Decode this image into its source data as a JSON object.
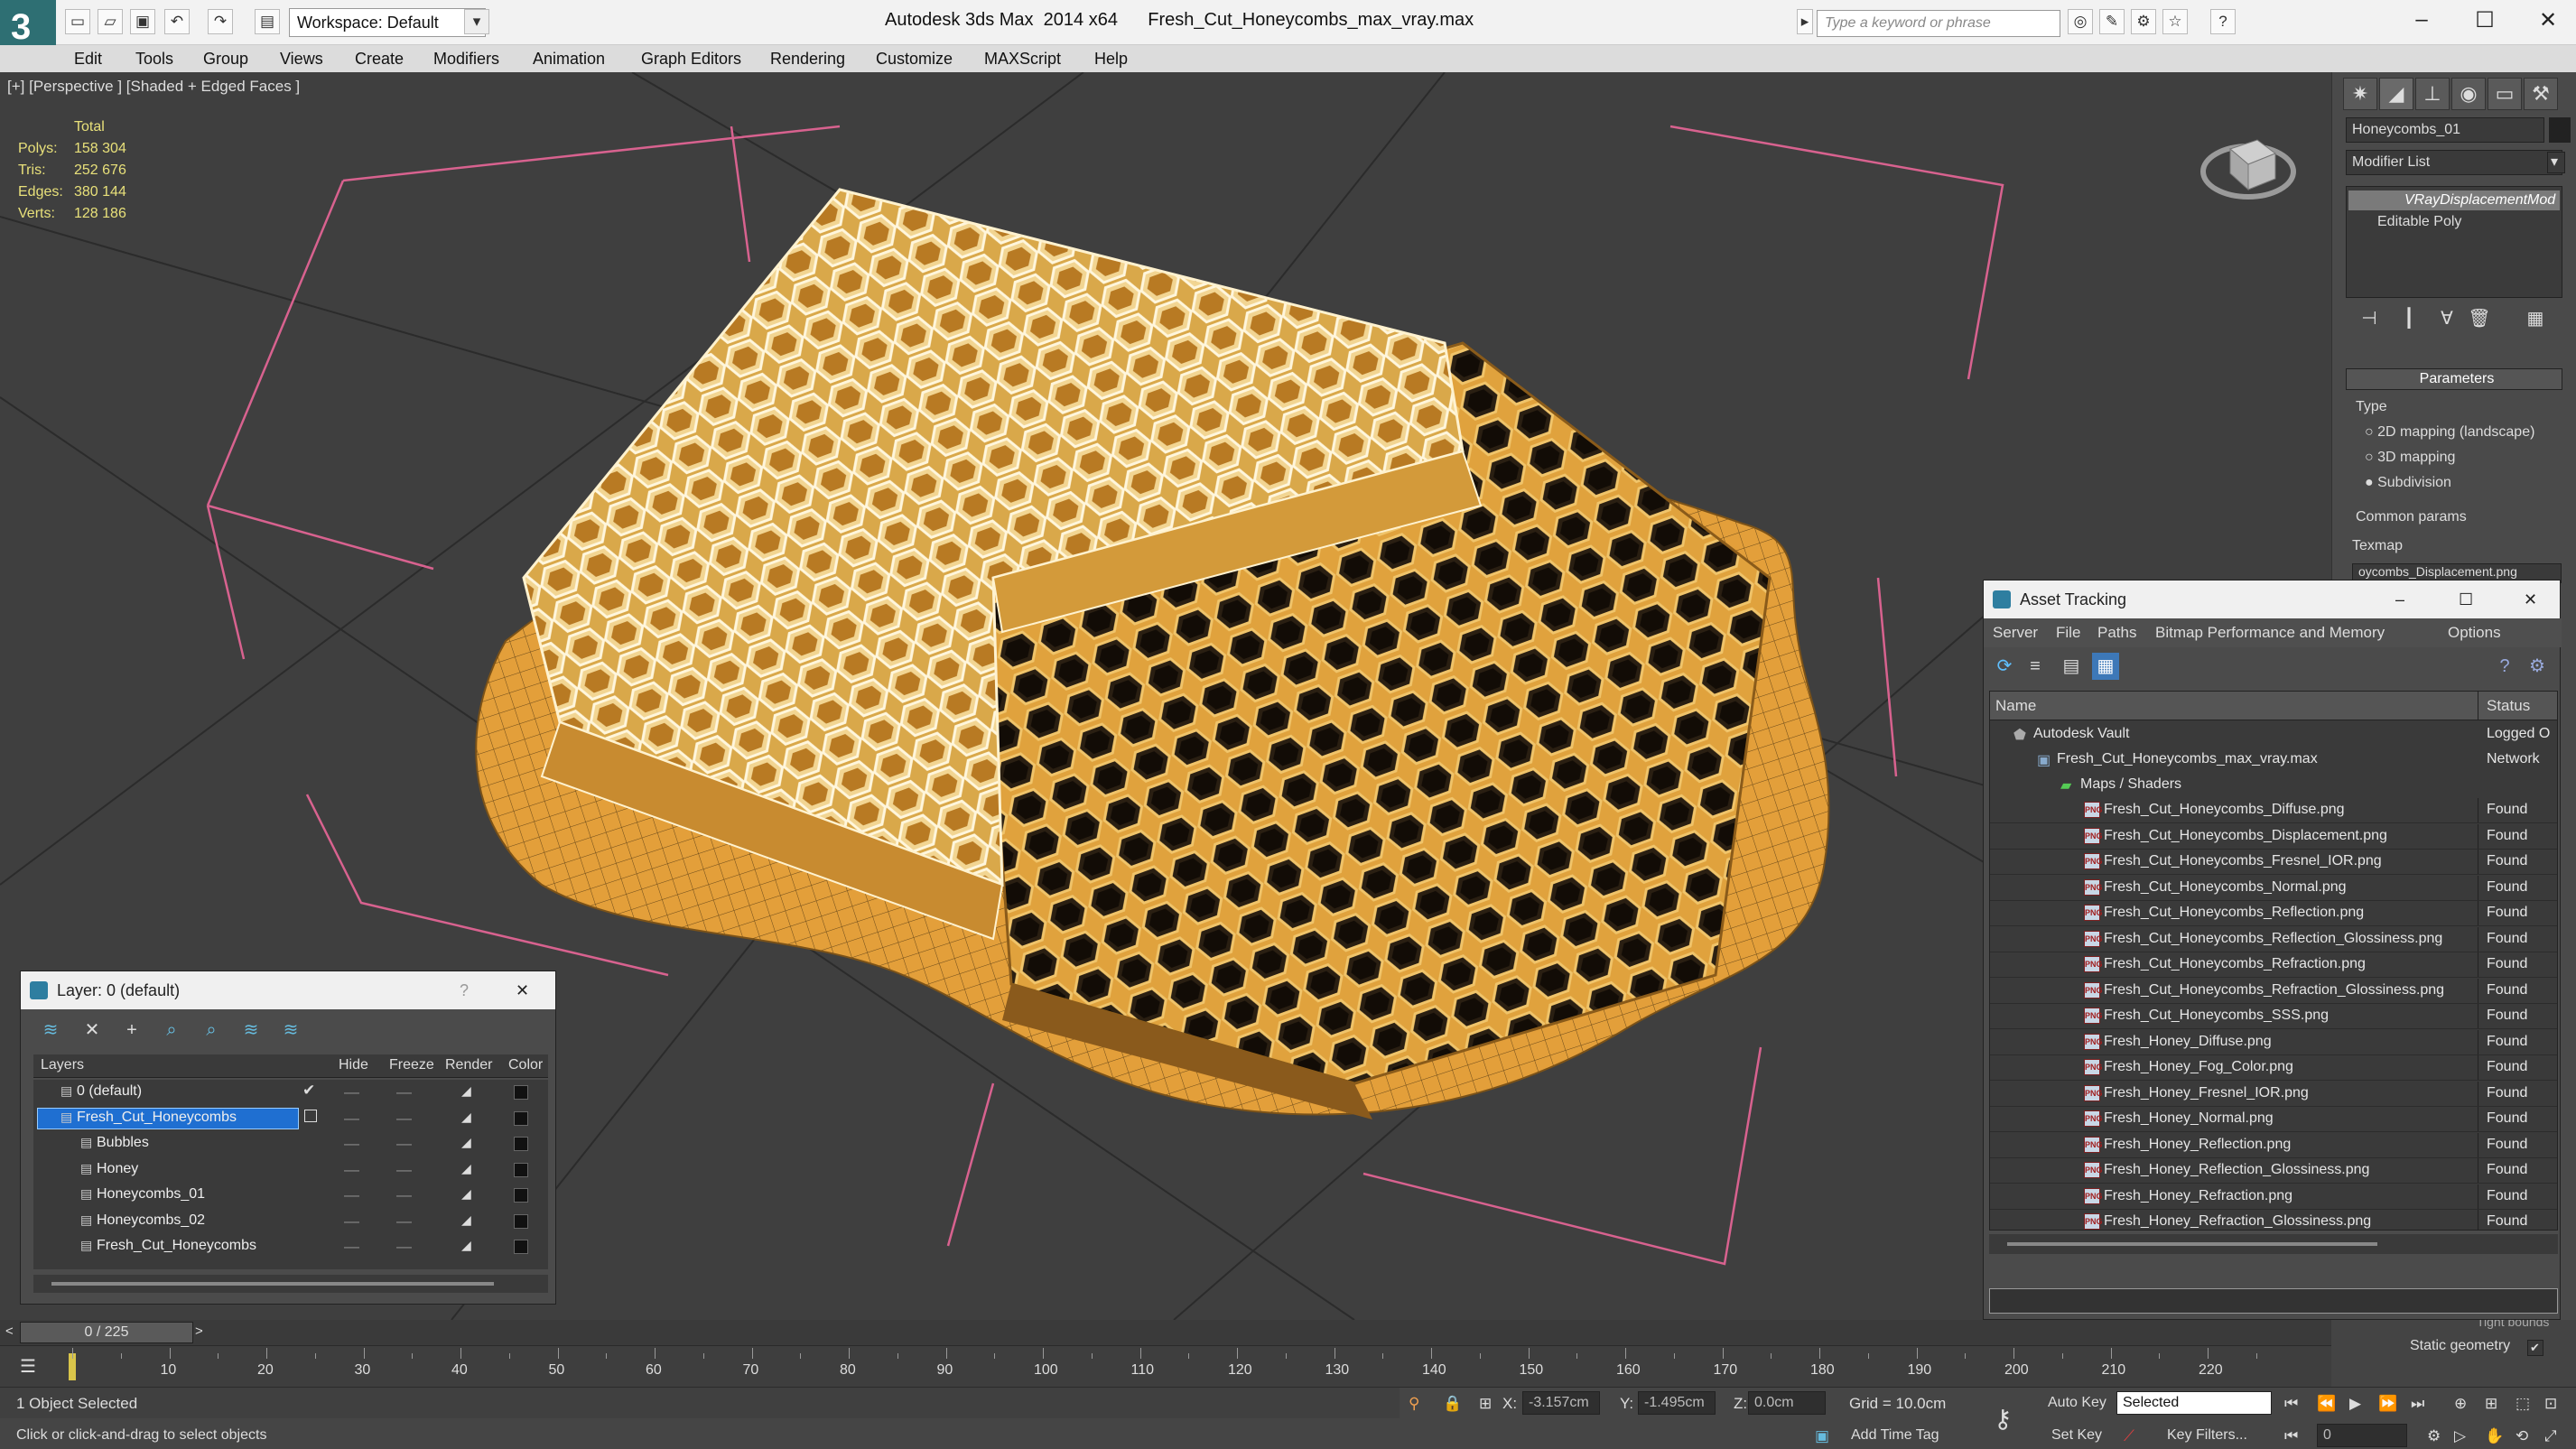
{
  "window": {
    "app_title": "Autodesk 3ds Max  2014 x64",
    "file_title": "Fresh_Cut_Honeycombs_max_vray.max",
    "workspace": "Workspace: Default",
    "search_placeholder": "Type a keyword or phrase",
    "minimize": "–",
    "maximize": "☐",
    "close": "✕"
  },
  "menu": [
    "Edit",
    "Tools",
    "Group",
    "Views",
    "Create",
    "Modifiers",
    "Animation",
    "Graph Editors",
    "Rendering",
    "Customize",
    "MAXScript",
    "Help"
  ],
  "viewport": {
    "label": "[+] [Perspective ] [Shaded + Edged Faces ]",
    "stats": {
      "header": "Total",
      "polys_label": "Polys:",
      "polys": "158 304",
      "tris_label": "Tris:",
      "tris": "252 676",
      "edges_label": "Edges:",
      "edges": "380 144",
      "verts_label": "Verts:",
      "verts": "128 186"
    },
    "colors": {
      "background": "#3f3f3f",
      "honey": "#e3a13c",
      "wire": "#f5e6b8",
      "grid": "#2a2a2a",
      "bounds": "#d8628f"
    }
  },
  "command_panel": {
    "object_name": "Honeycombs_01",
    "modifier_list": "Modifier List",
    "stack": [
      "VRayDisplacementMod",
      "Editable Poly"
    ],
    "rollout_title": "Parameters",
    "type_label": "Type",
    "options": [
      "2D mapping (landscape)",
      "3D mapping",
      "Subdivision"
    ],
    "common_params": "Common params",
    "texmap": "Texmap",
    "texmap_value": "oycombs_Displacement.png",
    "tight_bounds": "Tight bounds",
    "static_geometry": "Static geometry"
  },
  "asset_tracking": {
    "title": "Asset Tracking",
    "menu": [
      "Server",
      "File",
      "Paths",
      "Bitmap Performance and Memory",
      "Options"
    ],
    "col_name": "Name",
    "col_status": "Status",
    "vault": {
      "name": "Autodesk Vault",
      "status": "Logged O"
    },
    "file": {
      "name": "Fresh_Cut_Honeycombs_max_vray.max",
      "status": "Network"
    },
    "group": "Maps / Shaders",
    "maps": [
      {
        "name": "Fresh_Cut_Honeycombs_Diffuse.png",
        "status": "Found"
      },
      {
        "name": "Fresh_Cut_Honeycombs_Displacement.png",
        "status": "Found"
      },
      {
        "name": "Fresh_Cut_Honeycombs_Fresnel_IOR.png",
        "status": "Found"
      },
      {
        "name": "Fresh_Cut_Honeycombs_Normal.png",
        "status": "Found"
      },
      {
        "name": "Fresh_Cut_Honeycombs_Reflection.png",
        "status": "Found"
      },
      {
        "name": "Fresh_Cut_Honeycombs_Reflection_Glossiness.png",
        "status": "Found"
      },
      {
        "name": "Fresh_Cut_Honeycombs_Refraction.png",
        "status": "Found"
      },
      {
        "name": "Fresh_Cut_Honeycombs_Refraction_Glossiness.png",
        "status": "Found"
      },
      {
        "name": "Fresh_Cut_Honeycombs_SSS.png",
        "status": "Found"
      },
      {
        "name": "Fresh_Honey_Diffuse.png",
        "status": "Found"
      },
      {
        "name": "Fresh_Honey_Fog_Color.png",
        "status": "Found"
      },
      {
        "name": "Fresh_Honey_Fresnel_IOR.png",
        "status": "Found"
      },
      {
        "name": "Fresh_Honey_Normal.png",
        "status": "Found"
      },
      {
        "name": "Fresh_Honey_Reflection.png",
        "status": "Found"
      },
      {
        "name": "Fresh_Honey_Reflection_Glossiness.png",
        "status": "Found"
      },
      {
        "name": "Fresh_Honey_Refraction.png",
        "status": "Found"
      },
      {
        "name": "Fresh_Honey_Refraction_Glossiness.png",
        "status": "Found"
      }
    ]
  },
  "layer_dialog": {
    "title": "Layer: 0 (default)",
    "help": "?",
    "close": "✕",
    "cols": {
      "layers": "Layers",
      "hide": "Hide",
      "freeze": "Freeze",
      "render": "Render",
      "color": "Color"
    },
    "rows": [
      {
        "name": "0 (default)",
        "indent": 0,
        "selected": false
      },
      {
        "name": "Fresh_Cut_Honeycombs",
        "indent": 0,
        "selected": true
      },
      {
        "name": "Bubbles",
        "indent": 1,
        "selected": false
      },
      {
        "name": "Honey",
        "indent": 1,
        "selected": false
      },
      {
        "name": "Honeycombs_01",
        "indent": 1,
        "selected": false
      },
      {
        "name": "Honeycombs_02",
        "indent": 1,
        "selected": false
      },
      {
        "name": "Fresh_Cut_Honeycombs",
        "indent": 1,
        "selected": false
      }
    ]
  },
  "timeline": {
    "frame": "0 / 225",
    "ticks": [
      "10",
      "20",
      "30",
      "40",
      "50",
      "60",
      "70",
      "80",
      "90",
      "100",
      "110",
      "120",
      "130",
      "140",
      "150",
      "160",
      "170",
      "180",
      "190",
      "200",
      "210",
      "220"
    ]
  },
  "status": {
    "selected": "1 Object Selected",
    "prompt": "Click or click-and-drag to select objects",
    "x_label": "X:",
    "x": "-3.157cm",
    "y_label": "Y:",
    "y": "-1.495cm",
    "z_label": "Z:",
    "z": "0.0cm",
    "grid": "Grid = 10.0cm",
    "add_time_tag": "Add Time Tag",
    "auto_key": "Auto Key",
    "set_key": "Set Key",
    "selected_mode": "Selected",
    "key_filters": "Key Filters...",
    "frame_field": "0"
  }
}
